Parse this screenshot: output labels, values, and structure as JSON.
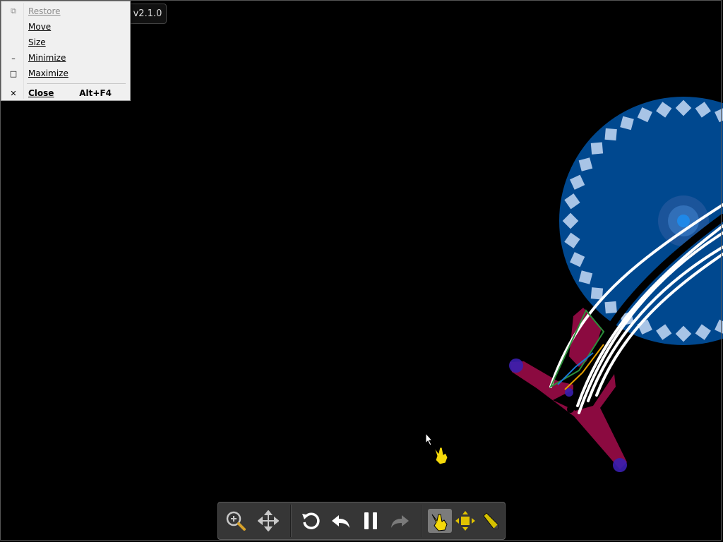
{
  "app": {
    "version": "v2.1.0"
  },
  "system_menu": {
    "items": [
      {
        "label": "Restore",
        "icon": "restore-icon",
        "enabled": false
      },
      {
        "label": "Move",
        "icon": "",
        "enabled": true
      },
      {
        "label": "Size",
        "icon": "",
        "enabled": true
      },
      {
        "label": "Minimize",
        "icon": "minimize-icon",
        "enabled": true
      },
      {
        "label": "Maximize",
        "icon": "maximize-icon",
        "enabled": true
      },
      {
        "label": "Close",
        "icon": "close-icon",
        "enabled": true,
        "accelerator": "Alt+F4"
      }
    ]
  },
  "toolbar": {
    "buttons": [
      {
        "name": "zoom-button",
        "icon": "zoom-in-icon",
        "active": false
      },
      {
        "name": "pan-button",
        "icon": "move-arrows-icon",
        "active": false
      },
      {
        "name": "reset-button",
        "icon": "rotate-reset-icon",
        "active": false
      },
      {
        "name": "step-back-button",
        "icon": "undo-arrow-icon",
        "active": false
      },
      {
        "name": "pause-button",
        "icon": "pause-icon",
        "active": false
      },
      {
        "name": "step-forward-button",
        "icon": "redo-arrow-icon",
        "active": false,
        "enabled": false
      },
      {
        "name": "grab-tool-button",
        "icon": "hand-pointer-icon",
        "active": true
      },
      {
        "name": "move-tool-button",
        "icon": "move-shape-icon",
        "active": false
      },
      {
        "name": "draw-tool-button",
        "icon": "pencil-icon",
        "active": false
      }
    ]
  },
  "colors": {
    "background": "#000000",
    "wheel": "#00488f",
    "wheel_teeth": "#a8c4e6",
    "body": "#8b0a40",
    "joint": "#3a1fb0",
    "ropes": "#ffffff",
    "accent_yellow": "#f2d600"
  }
}
